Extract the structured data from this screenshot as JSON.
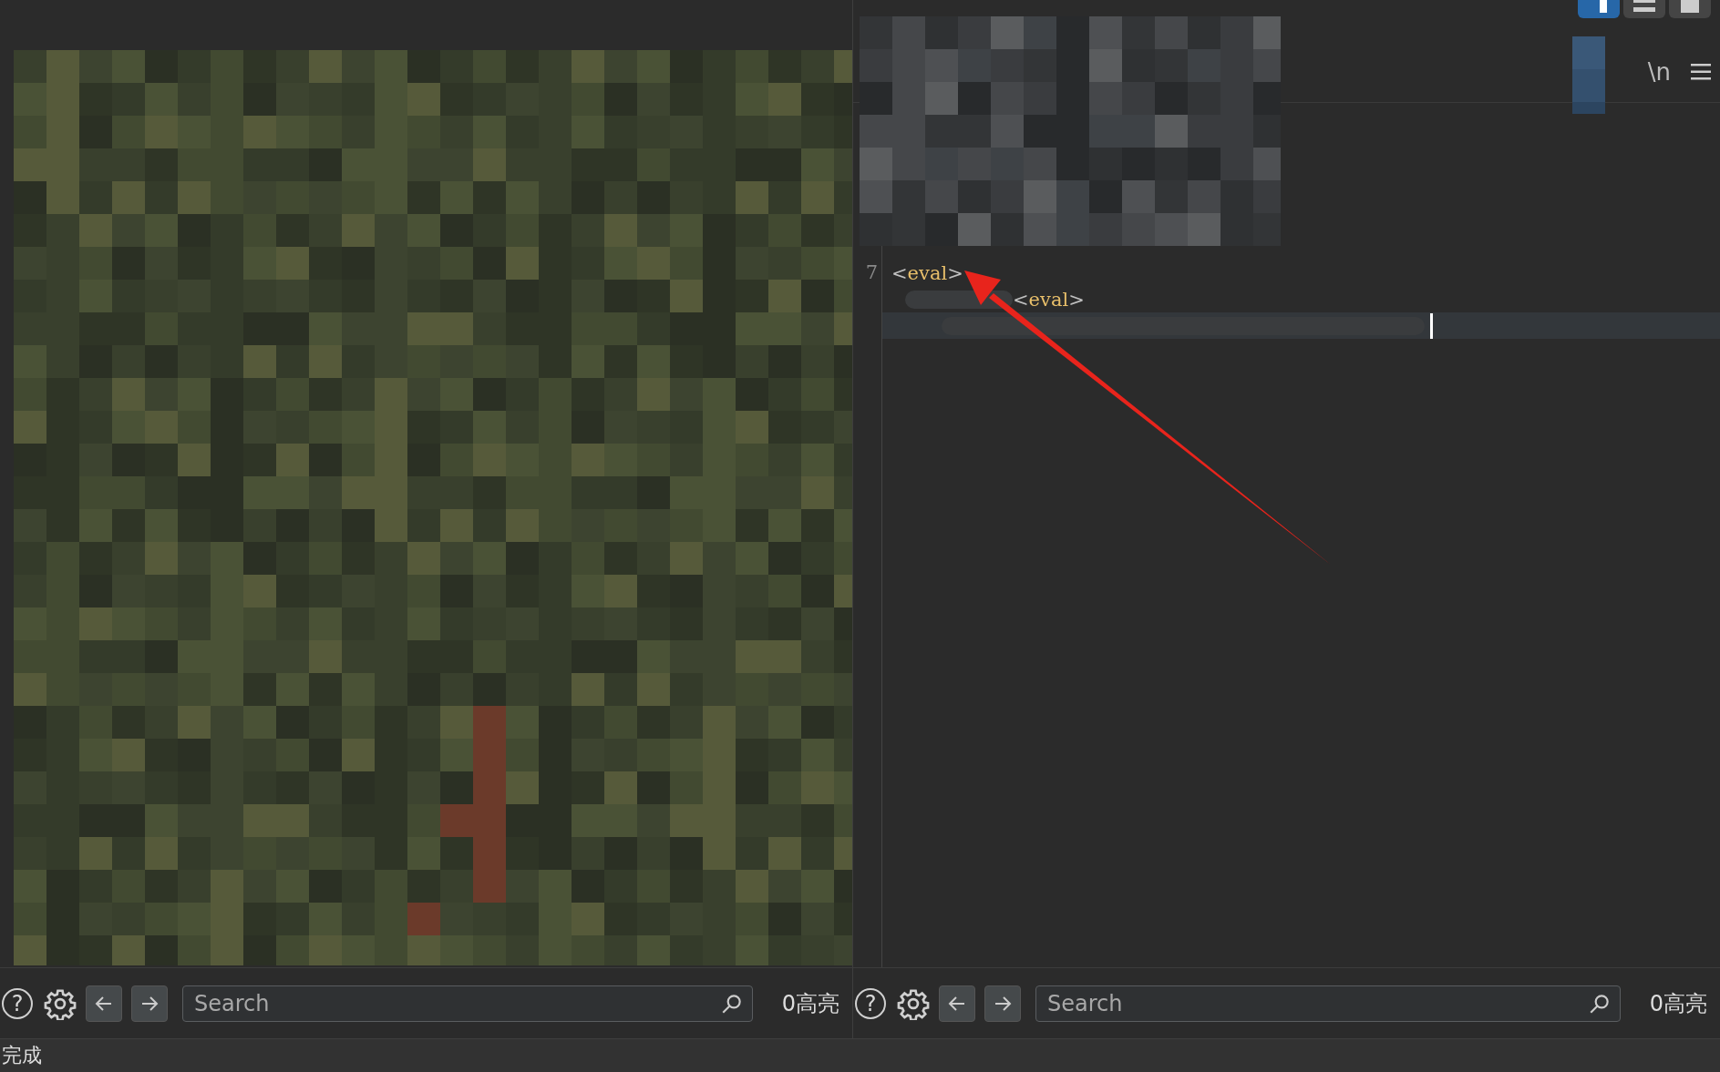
{
  "left_pane": {
    "content": {
      "kind": "mosaic"
    },
    "find_bar": {
      "help_icon": "?",
      "search": {
        "placeholder": "Search"
      },
      "highlights": "0高亮"
    }
  },
  "right_pane": {
    "toolbar": {
      "newline_button": "\\n"
    },
    "cover": {
      "kind": "mosaic"
    },
    "editor": {
      "lines": [
        {
          "number": "7",
          "tokens": [
            {
              "text": "<",
              "kind": "punct"
            },
            {
              "text": "eval",
              "kind": "tag"
            },
            {
              "text": ">",
              "kind": "punct"
            }
          ]
        },
        {
          "redacted": true,
          "tokens": [
            {
              "text": "<",
              "kind": "punct"
            },
            {
              "text": "eval",
              "kind": "tag"
            },
            {
              "text": ">",
              "kind": "punct"
            }
          ]
        },
        {
          "current": true,
          "redacted": true,
          "caret": true
        }
      ]
    },
    "annotation": {
      "kind": "arrow"
    },
    "find_bar": {
      "help_icon": "?",
      "search": {
        "placeholder": "Search"
      },
      "highlights": "0高亮"
    }
  },
  "status_bar": {
    "text": "完成"
  }
}
